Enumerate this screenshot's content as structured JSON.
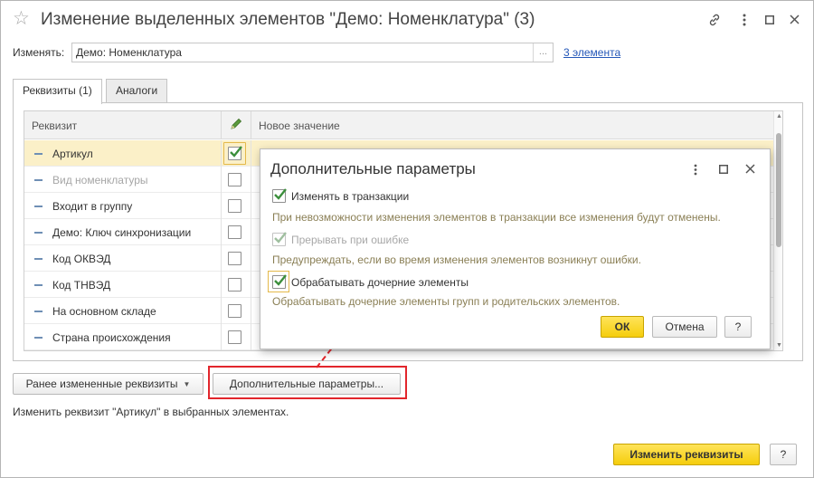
{
  "window": {
    "title": "Изменение выделенных элементов \"Демо: Номенклатура\" (3)",
    "controls": [
      "link-icon",
      "more-icon",
      "maximize-icon",
      "close-icon"
    ]
  },
  "change_row": {
    "label": "Изменять:",
    "value": "Демо: Номенклатура",
    "select_button": "...",
    "count_link": "3 элемента"
  },
  "tabs": [
    {
      "label": "Реквизиты (1)",
      "active": true
    },
    {
      "label": "Аналоги",
      "active": false
    }
  ],
  "grid": {
    "columns": [
      "Реквизит",
      "Новое значение"
    ],
    "rows": [
      {
        "label": "Артикул",
        "checked": true,
        "disabled": false,
        "selected": true
      },
      {
        "label": "Вид номенклатуры",
        "checked": false,
        "disabled": true,
        "selected": false
      },
      {
        "label": "Входит в группу",
        "checked": false,
        "disabled": false,
        "selected": false
      },
      {
        "label": "Демо: Ключ синхронизации",
        "checked": false,
        "disabled": false,
        "selected": false
      },
      {
        "label": "Код ОКВЭД",
        "checked": false,
        "disabled": false,
        "selected": false
      },
      {
        "label": "Код ТНВЭД",
        "checked": false,
        "disabled": false,
        "selected": false
      },
      {
        "label": "На основном складе",
        "checked": false,
        "disabled": false,
        "selected": false
      },
      {
        "label": "Страна происхождения",
        "checked": false,
        "disabled": false,
        "selected": false
      }
    ]
  },
  "buttons": {
    "previously_changed": "Ранее измененные реквизиты",
    "additional_params": "Дополнительные параметры...",
    "change": "Изменить реквизиты",
    "help": "?"
  },
  "hint": "Изменить реквизит \"Артикул\" в выбранных элементах.",
  "popup": {
    "title": "Дополнительные параметры",
    "options": [
      {
        "label": "Изменять в транзакции",
        "checked": true,
        "disabled": false,
        "description": "При невозможности изменения элементов в транзакции все изменения будут отменены."
      },
      {
        "label": "Прерывать при ошибке",
        "checked": true,
        "disabled": true,
        "description": "Предупреждать, если во время изменения элементов возникнут ошибки."
      },
      {
        "label": "Обрабатывать дочерние элементы",
        "checked": true,
        "disabled": false,
        "description": "Обрабатывать дочерние элементы групп и родительских элементов."
      }
    ],
    "ok": "ОК",
    "cancel": "Отмена",
    "help": "?"
  },
  "colors": {
    "accent_yellow": "#f5cd0c",
    "check_green": "#3c8f3c",
    "highlight_red": "#e2262c",
    "link_blue": "#2457b8",
    "selected_row": "#fbf0c8"
  }
}
